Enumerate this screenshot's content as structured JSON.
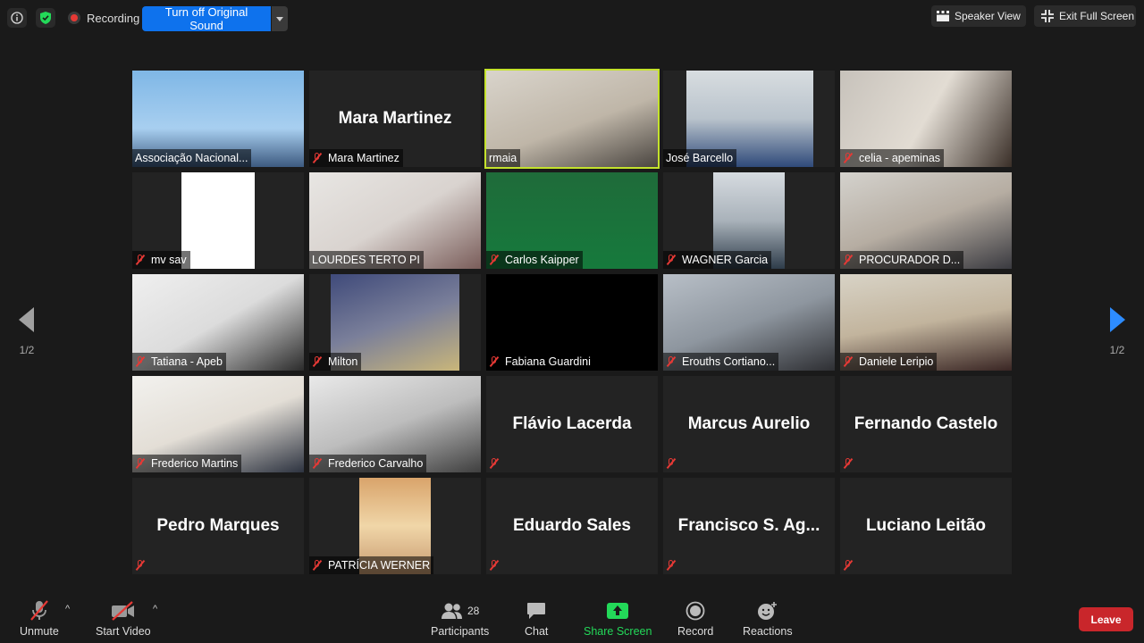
{
  "topbar": {
    "recording_label": "Recording",
    "orig_sound_label": "Turn off Original Sound",
    "speaker_view_label": "Speaker View",
    "exit_fullscreen_label": "Exit Full Screen"
  },
  "pagination": {
    "left": "1/2",
    "right": "1/2"
  },
  "tiles": [
    {
      "name": "Associação Nacional...",
      "video": true,
      "muted": false
    },
    {
      "name": "Mara Martinez",
      "video": false,
      "muted": true,
      "center": "Mara Martinez"
    },
    {
      "name": "rmaia",
      "video": true,
      "muted": false,
      "active": true
    },
    {
      "name": "José Barcello",
      "video": true,
      "muted": false
    },
    {
      "name": "celia - apeminas",
      "video": true,
      "muted": true
    },
    {
      "name": "mv sav",
      "video": true,
      "muted": true
    },
    {
      "name": "LOURDES TERTO PI",
      "video": true,
      "muted": false
    },
    {
      "name": "Carlos Kaipper",
      "video": true,
      "muted": true
    },
    {
      "name": "WAGNER Garcia",
      "video": true,
      "muted": true
    },
    {
      "name": "PROCURADOR D...",
      "video": true,
      "muted": true
    },
    {
      "name": "Tatiana - Apeb",
      "video": true,
      "muted": true
    },
    {
      "name": "Milton",
      "video": true,
      "muted": true
    },
    {
      "name": "Fabiana Guardini",
      "video": false,
      "muted": true
    },
    {
      "name": "Erouths Cortiano...",
      "video": true,
      "muted": true
    },
    {
      "name": "Daniele Leripio",
      "video": true,
      "muted": true
    },
    {
      "name": "Frederico Martins",
      "video": true,
      "muted": true
    },
    {
      "name": "Frederico Carvalho",
      "video": true,
      "muted": true
    },
    {
      "name": "",
      "video": false,
      "muted": true,
      "center": "Flávio Lacerda"
    },
    {
      "name": "",
      "video": false,
      "muted": true,
      "center": "Marcus Aurelio"
    },
    {
      "name": "",
      "video": false,
      "muted": true,
      "center": "Fernando Castelo"
    },
    {
      "name": "",
      "video": false,
      "muted": true,
      "center": "Pedro Marques"
    },
    {
      "name": "PATRÍCIA WERNER",
      "video": true,
      "muted": true
    },
    {
      "name": "",
      "video": false,
      "muted": true,
      "center": "Eduardo Sales"
    },
    {
      "name": "",
      "video": false,
      "muted": true,
      "center": "Francisco S. Ag..."
    },
    {
      "name": "",
      "video": false,
      "muted": true,
      "center": "Luciano Leitão"
    }
  ],
  "toolbar": {
    "unmute": "Unmute",
    "start_video": "Start Video",
    "participants": "Participants",
    "participants_count": "28",
    "chat": "Chat",
    "share_screen": "Share Screen",
    "record": "Record",
    "reactions": "Reactions",
    "leave": "Leave"
  },
  "colors": {
    "accent": "#0e72ed",
    "share_green": "#23d959",
    "leave_red": "#c9262b",
    "active_border": "#c4e22c",
    "muted_red": "#e53935"
  }
}
